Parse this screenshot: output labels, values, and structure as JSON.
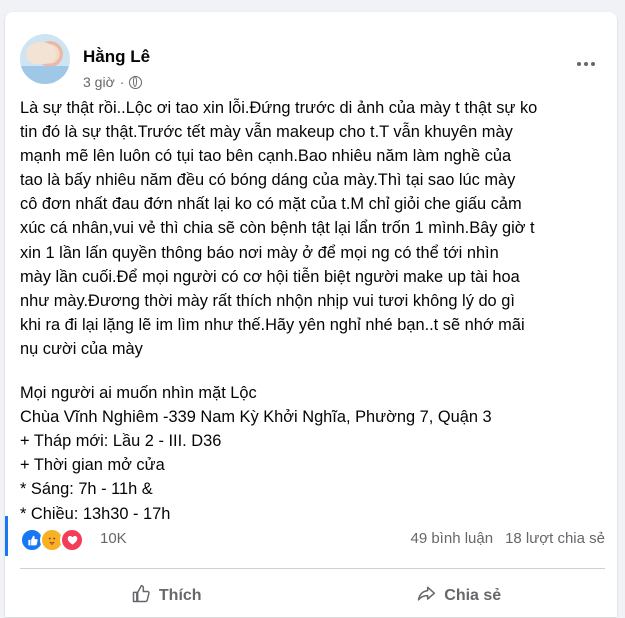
{
  "post": {
    "author": "Hằng Lê",
    "time": "3 giờ",
    "dot": "·",
    "paragraph1": [
      "Là sự thật rồi..Lộc ơi tao xin lỗi.Đứng trước di ảnh của mày t thật sự ko",
      "tin đó là sự thật.Trước tết mày vẫn makeup cho t.T vẫn khuyên mày",
      "mạnh mẽ lên luôn có tụi tao bên cạnh.Bao nhiêu năm làm nghề của",
      "tao là bấy nhiêu năm đều có bóng dáng của mày.Thì tại sao lúc mày",
      "cô đơn nhất đau đớn nhất lại ko có mặt của t.M chỉ giỏi che giấu cảm",
      "xúc cá nhân,vui vẻ thì chia sẽ còn bệnh tật lại lẩn trốn 1 mình.Bây giờ t",
      "xin 1 lần lấn quyền thông báo nơi mày ở để mọi ng có thể tới nhìn",
      "mày lần cuối.Để mọi người có cơ hội tiễn biệt người make up tài hoa",
      "như mày.Đương thời mày rất thích nhộn nhịp vui tươi không lý do gì",
      "khi ra đi lại lặng lẽ im lìm như thế.Hãy yên nghỉ nhé bạn..t sẽ nhớ mãi",
      "nụ cười của mày"
    ],
    "paragraph2": [
      "Mọi người ai muốn nhìn mặt Lộc",
      "Chùa Vĩnh Nghiêm -339 Nam Kỳ Khởi Nghĩa, Phường 7, Quận 3",
      "+ Tháp mới: Lầu 2 - III. D36",
      "+ Thời gian mở cửa",
      "* Sáng: 7h - 11h &",
      "* Chiều: 13h30 - 17h"
    ]
  },
  "stats": {
    "reactions_count": "10K",
    "comments": "49 bình luận",
    "shares": "18 lượt chia sẻ"
  },
  "actions": {
    "like": "Thích",
    "share": "Chia sẻ"
  },
  "icons": [
    "globe-icon",
    "more-icon",
    "like-reaction-icon",
    "care-reaction-icon",
    "love-reaction-icon",
    "thumbs-up-icon",
    "share-arrow-icon"
  ]
}
